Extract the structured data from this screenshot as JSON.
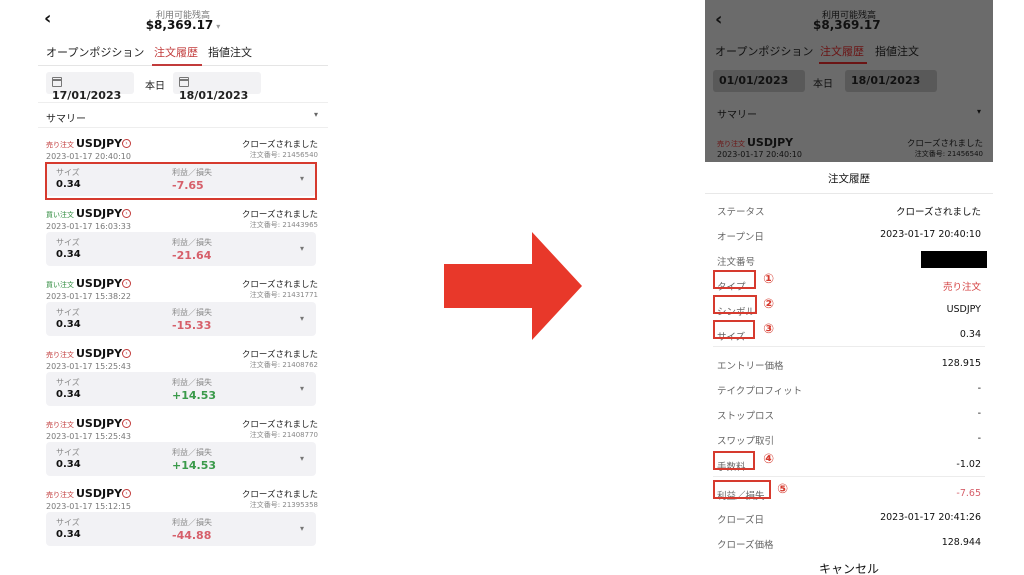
{
  "header": {
    "back_icon": "‹",
    "balance_label": "利用可能残高",
    "balance_value": "$8,369.17",
    "balance_caret": "▾"
  },
  "tabs": [
    "オープンポジション",
    "注文履歴",
    "指値注文"
  ],
  "left_dates": {
    "from": "17/01/2023",
    "today": "本日",
    "to": "18/01/2023"
  },
  "right_dates": {
    "from": "01/01/2023",
    "today": "本日",
    "to": "18/01/2023"
  },
  "summary_label": "サマリー",
  "chevron": "▾",
  "size_label": "サイズ",
  "pl_label": "利益／損失",
  "orders": [
    {
      "type": "売り注文",
      "type_kind": "sell",
      "symbol": "USDJPY",
      "time": "2023-01-17 20:40:10",
      "status": "クローズされました",
      "number": "注文番号: 21456540",
      "size": "0.34",
      "pl": "-7.65",
      "pl_kind": "neg"
    },
    {
      "type": "買い注文",
      "type_kind": "buy",
      "symbol": "USDJPY",
      "time": "2023-01-17 16:03:33",
      "status": "クローズされました",
      "number": "注文番号: 21443965",
      "size": "0.34",
      "pl": "-21.64",
      "pl_kind": "neg"
    },
    {
      "type": "買い注文",
      "type_kind": "buy",
      "symbol": "USDJPY",
      "time": "2023-01-17 15:38:22",
      "status": "クローズされました",
      "number": "注文番号: 21431771",
      "size": "0.34",
      "pl": "-15.33",
      "pl_kind": "neg"
    },
    {
      "type": "売り注文",
      "type_kind": "sell",
      "symbol": "USDJPY",
      "time": "2023-01-17 15:25:43",
      "status": "クローズされました",
      "number": "注文番号: 21408762",
      "size": "0.34",
      "pl": "+14.53",
      "pl_kind": "pos"
    },
    {
      "type": "売り注文",
      "type_kind": "sell",
      "symbol": "USDJPY",
      "time": "2023-01-17 15:25:43",
      "status": "クローズされました",
      "number": "注文番号: 21408770",
      "size": "0.34",
      "pl": "+14.53",
      "pl_kind": "pos"
    },
    {
      "type": "売り注文",
      "type_kind": "sell",
      "symbol": "USDJPY",
      "time": "2023-01-17 15:12:15",
      "status": "クローズされました",
      "number": "注文番号: 21395358",
      "size": "0.34",
      "pl": "-44.88",
      "pl_kind": "neg"
    }
  ],
  "dim_order": {
    "type": "売り注文",
    "symbol": "USDJPY",
    "time": "2023-01-17 20:40:10",
    "status": "クローズされました",
    "number": "注文番号: 21456540"
  },
  "detail": {
    "title": "注文履歴",
    "rows": [
      {
        "label": "ステータス",
        "value": "クローズされました"
      },
      {
        "label": "オープン日",
        "value": "2023-01-17 20:40:10"
      },
      {
        "label": "注文番号",
        "value": ""
      },
      {
        "label": "タイプ",
        "value": "売り注文"
      },
      {
        "label": "シンボル",
        "value": "USDJPY"
      },
      {
        "label": "サイズ",
        "value": "0.34"
      },
      {
        "label": "エントリー価格",
        "value": "128.915"
      },
      {
        "label": "テイクプロフィット",
        "value": "-"
      },
      {
        "label": "ストップロス",
        "value": "-"
      },
      {
        "label": "スワップ取引",
        "value": "-"
      },
      {
        "label": "手数料",
        "value": "-1.02"
      },
      {
        "label": "利益／損失",
        "value": "-7.65"
      },
      {
        "label": "クローズ日",
        "value": "2023-01-17 20:41:26"
      },
      {
        "label": "クローズ価格",
        "value": "128.944"
      }
    ],
    "markers": [
      "①",
      "②",
      "③",
      "④",
      "⑤"
    ],
    "cancel_label": "キャンセル"
  },
  "colors": {
    "accent_red": "#d63a2e",
    "sell": "#c23b3b",
    "buy": "#2e8b3d",
    "loss": "#d65f6a",
    "profit": "#3a9a4a"
  }
}
